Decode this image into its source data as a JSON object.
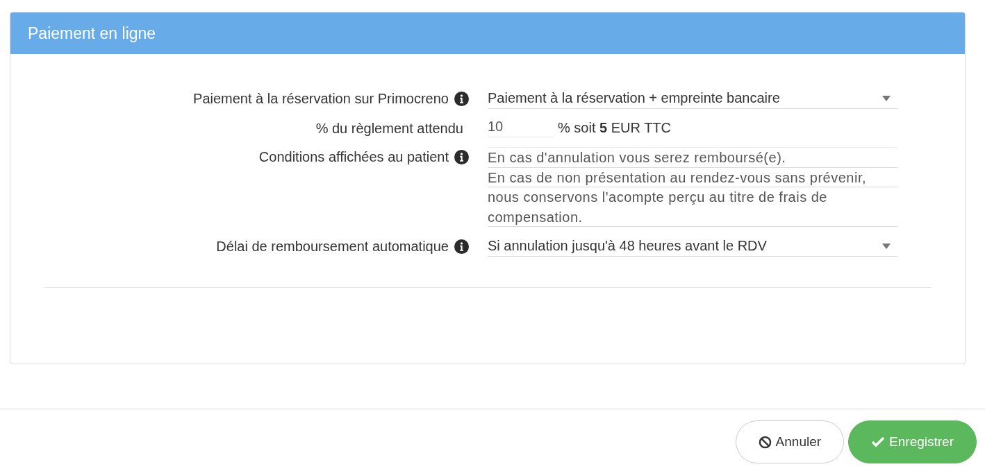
{
  "panel": {
    "title": "Paiement en ligne"
  },
  "fields": [
    {
      "kind": "select",
      "label": "Paiement à la réservation sur Primocreno",
      "info": true,
      "value": "Paiement à la réservation + empreinte bancaire"
    },
    {
      "kind": "percent",
      "label": "% du règlement attendu",
      "info": false,
      "value": "10",
      "suffix": "% soit  **5** EUR TTC"
    },
    {
      "kind": "textarea",
      "label": "Conditions affichées au patient",
      "info": true,
      "value": "En cas d'annulation vous serez remboursé(e).\nEn cas de non présentation au rendez-vous sans prévenir, nous conservons l'acompte perçu au titre de frais de compensation."
    },
    {
      "kind": "select",
      "label": "Délai de remboursement automatique",
      "info": true,
      "value": "Si annulation jusqu'à 48 heures avant le RDV"
    }
  ],
  "buttons": [
    {
      "kind": "cancel",
      "label": "Annuler"
    },
    {
      "kind": "save",
      "label": "Enregistrer"
    }
  ]
}
